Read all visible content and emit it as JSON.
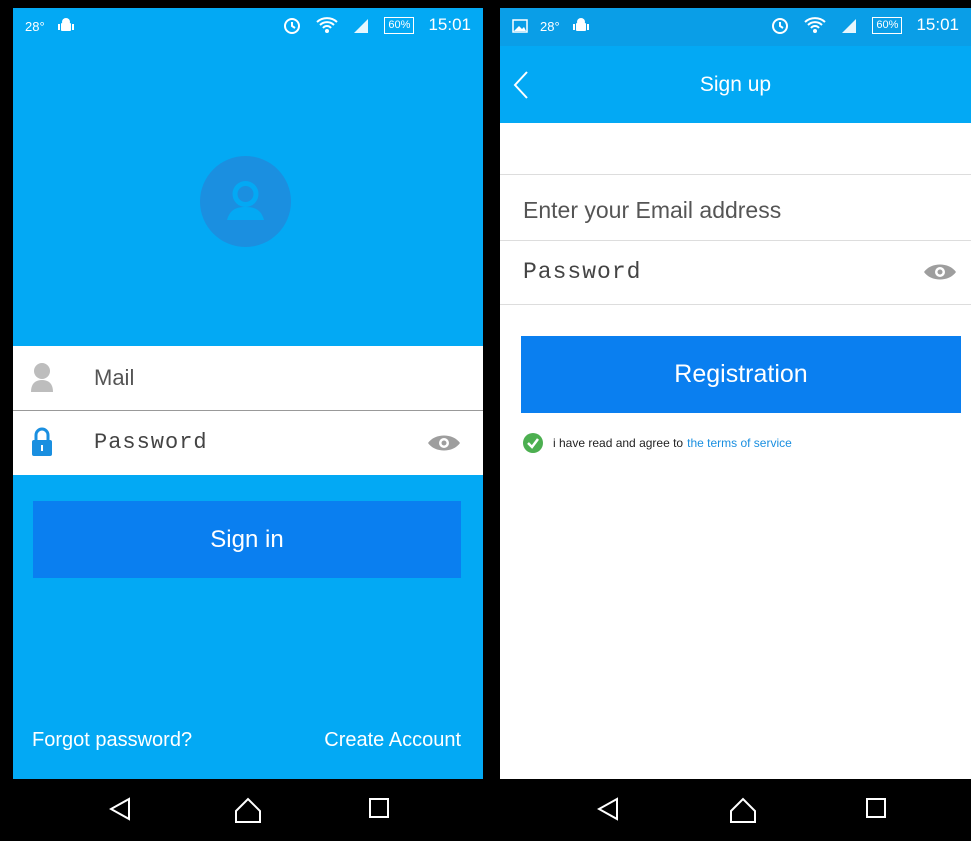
{
  "status": {
    "temp": "28°",
    "battery": "60%",
    "time": "15:01"
  },
  "login": {
    "mail_placeholder": "Mail",
    "password_placeholder": "Password",
    "signin_label": "Sign in",
    "forgot_label": "Forgot password?",
    "create_label": "Create Account"
  },
  "signup": {
    "title": "Sign up",
    "email_placeholder": "Enter your Email address",
    "password_placeholder": "Password",
    "register_label": "Registration",
    "terms_text": "i have read and agree to",
    "terms_link": "the terms of service"
  },
  "icons": [
    "android-icon",
    "alarm-icon",
    "wifi-icon",
    "signal-icon",
    "battery-icon",
    "user-avatar-icon",
    "user-icon",
    "lock-icon",
    "eye-icon",
    "back-icon",
    "home-icon",
    "recents-icon",
    "image-icon",
    "check-icon"
  ],
  "colors": {
    "primary": "#03a9f4",
    "button": "#0a7ff0",
    "check": "#4caf50",
    "link": "#1a8fe0"
  }
}
